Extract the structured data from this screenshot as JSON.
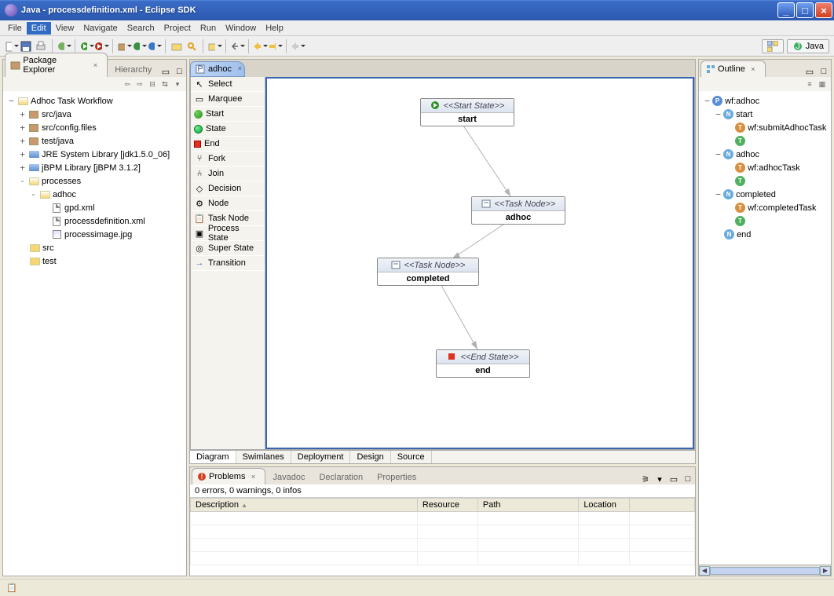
{
  "window": {
    "title": "Java - processdefinition.xml - Eclipse SDK"
  },
  "menu": [
    "File",
    "Edit",
    "View",
    "Navigate",
    "Search",
    "Project",
    "Run",
    "Window",
    "Help"
  ],
  "menu_active": "Edit",
  "perspective": {
    "label": "Java"
  },
  "left": {
    "tabs": [
      "Package Explorer",
      "Hierarchy"
    ],
    "tree": {
      "root": "Adhoc Task Workflow",
      "children": [
        {
          "label": "src/java",
          "icon": "pkg",
          "toggle": "+"
        },
        {
          "label": "src/config.files",
          "icon": "pkg",
          "toggle": "+"
        },
        {
          "label": "test/java",
          "icon": "pkg",
          "toggle": "+"
        },
        {
          "label": "JRE System Library [jdk1.5.0_06]",
          "icon": "lib",
          "toggle": "+"
        },
        {
          "label": "jBPM Library [jBPM 3.1.2]",
          "icon": "lib",
          "toggle": "+"
        },
        {
          "label": "processes",
          "icon": "folder",
          "toggle": "-",
          "children": [
            {
              "label": "adhoc",
              "icon": "folder",
              "toggle": "-",
              "children": [
                {
                  "label": "gpd.xml",
                  "icon": "file"
                },
                {
                  "label": "processdefinition.xml",
                  "icon": "file"
                },
                {
                  "label": "processimage.jpg",
                  "icon": "img"
                }
              ]
            }
          ]
        },
        {
          "label": "src",
          "icon": "folder",
          "toggle": ""
        },
        {
          "label": "test",
          "icon": "folder",
          "toggle": ""
        }
      ]
    }
  },
  "editor": {
    "tab": "adhoc",
    "palette": [
      {
        "label": "Select",
        "icon": "cursor"
      },
      {
        "label": "Marquee",
        "icon": "marquee"
      },
      {
        "label": "Start",
        "icon": "start"
      },
      {
        "label": "State",
        "icon": "state"
      },
      {
        "label": "End",
        "icon": "end"
      },
      {
        "label": "Fork",
        "icon": "fork"
      },
      {
        "label": "Join",
        "icon": "join"
      },
      {
        "label": "Decision",
        "icon": "decision"
      },
      {
        "label": "Node",
        "icon": "node"
      },
      {
        "label": "Task Node",
        "icon": "tasknode"
      },
      {
        "label": "Process State",
        "icon": "procstate"
      },
      {
        "label": "Super State",
        "icon": "superstate"
      },
      {
        "label": "Transition",
        "icon": "arrow"
      }
    ],
    "nodes": {
      "start": {
        "stereo": "<<Start State>>",
        "name": "start"
      },
      "adhoc": {
        "stereo": "<<Task Node>>",
        "name": "adhoc"
      },
      "completed": {
        "stereo": "<<Task Node>>",
        "name": "completed"
      },
      "end": {
        "stereo": "<<End State>>",
        "name": "end"
      }
    },
    "bottom_tabs": [
      "Diagram",
      "Swimlanes",
      "Deployment",
      "Design",
      "Source"
    ]
  },
  "bottom": {
    "tabs": [
      "Problems",
      "Javadoc",
      "Declaration",
      "Properties"
    ],
    "summary": "0 errors, 0 warnings, 0 infos",
    "columns": [
      "Description",
      "Resource",
      "Path",
      "Location"
    ]
  },
  "outline": {
    "title": "Outline",
    "tree": [
      {
        "icon": "p",
        "label": "wf:adhoc",
        "toggle": "-",
        "children": [
          {
            "icon": "n",
            "label": "start",
            "toggle": "-",
            "children": [
              {
                "icon": "t",
                "label": "wf:submitAdhocTask"
              },
              {
                "icon": "i",
                "label": ""
              }
            ]
          },
          {
            "icon": "n",
            "label": "adhoc",
            "toggle": "-",
            "children": [
              {
                "icon": "t",
                "label": "wf:adhocTask"
              },
              {
                "icon": "i",
                "label": ""
              }
            ]
          },
          {
            "icon": "n",
            "label": "completed",
            "toggle": "-",
            "children": [
              {
                "icon": "t",
                "label": "wf:completedTask"
              },
              {
                "icon": "i",
                "label": ""
              }
            ]
          },
          {
            "icon": "n",
            "label": "end",
            "toggle": ""
          }
        ]
      }
    ]
  }
}
